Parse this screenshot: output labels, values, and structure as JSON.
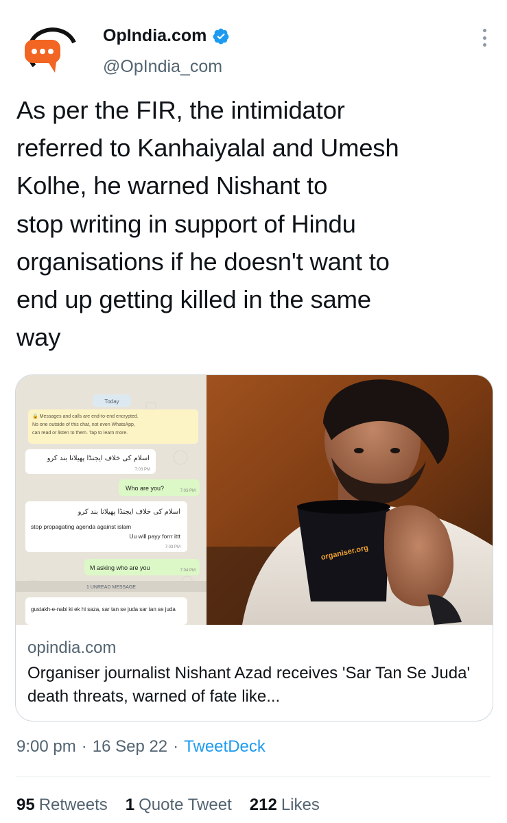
{
  "tweet": {
    "author": {
      "name": "OpIndia.com",
      "handle": "@OpIndia_com",
      "verified": true
    },
    "text": "As per the FIR, the intimidator\nreferred to Kanhaiyalal and Umesh\nKolhe, he warned Nishant to\nstop writing in support of Hindu\norganisations if he doesn't want to\nend up getting killed in the same\nway",
    "card": {
      "domain": "opindia.com",
      "title": "Organiser journalist Nishant Azad receives 'Sar Tan Se Juda' death threats, warned of fate like...",
      "chat": {
        "day": "Today",
        "encryption_notice": "Messages and calls are end-to-end encrypted. No one outside of this chat, not even WhatsApp, can read or listen to them. Tap to learn more.",
        "messages": [
          {
            "dir": "in",
            "text": "اسلام کی خلاف ایجنڈا پھیلانا بند کرو",
            "time": "7:03 PM"
          },
          {
            "dir": "out",
            "text": "Who are you?",
            "time": "7:03 PM"
          },
          {
            "dir": "in",
            "text": "اسلام کی خلاف ایجنڈا پھیلانا بند کرو",
            "text2": "stop propagating agenda against islam",
            "text3": "Uu will payy forrr ittt",
            "time": "7:03 PM"
          },
          {
            "dir": "out",
            "text": "M asking who are you",
            "time": "7:04 PM"
          }
        ],
        "unread": "1 UNREAD MESSAGE",
        "last": "gustakh-e-nabi ki ek hi saza, sar tan se juda sar tan se juda"
      },
      "mug_text": "organiser.org"
    },
    "meta": {
      "time": "9:00 pm",
      "date": "16 Sep 22",
      "source": "TweetDeck"
    },
    "stats": {
      "retweets_count": "95",
      "retweets_label": "Retweets",
      "quotes_count": "1",
      "quotes_label": "Quote Tweet",
      "likes_count": "212",
      "likes_label": "Likes"
    }
  },
  "colors": {
    "brand": "#f26522",
    "link": "#1d9bf0",
    "muted": "#536471",
    "text": "#0f1419",
    "border": "#cfd9de",
    "chat_bg": "#e8e3d9",
    "chat_out": "#dcf8c6",
    "notice_bg": "#fdf4c5"
  },
  "icons": {
    "avatar": "opindia-speech-bubble-logo",
    "verified": "verified-badge-icon",
    "more": "more-options-icon"
  }
}
